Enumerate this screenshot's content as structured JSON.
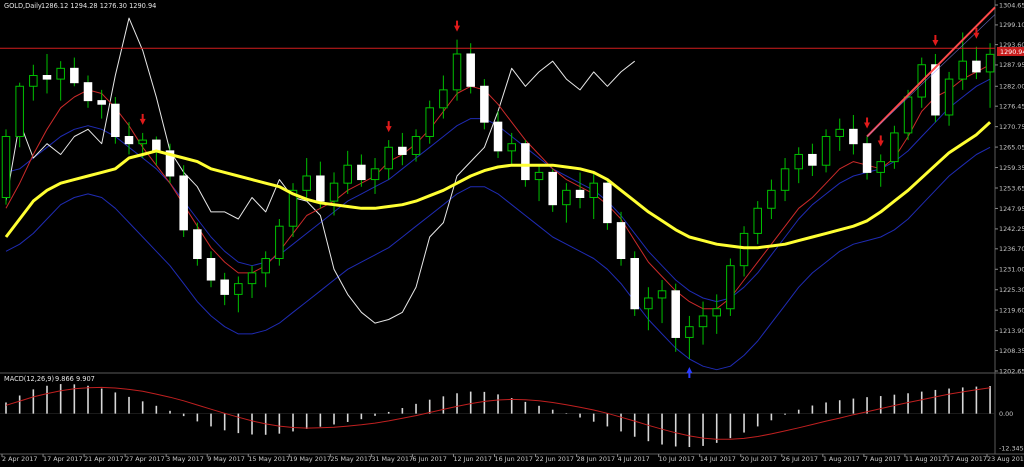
{
  "colors": {
    "background": "#000000",
    "grid": "#2a2a2a",
    "bull": "#ffffff",
    "bear": "#ffffff",
    "wick": "#00c000",
    "ma_slow": "#ffff33",
    "ma_red": "#cc2a2a",
    "ma_white": "#e8e8e8",
    "band_blue": "#1f2bb3",
    "level_line": "#d21e1e",
    "arrow_down": "#e01b1b",
    "arrow_up": "#2a3cff",
    "axis_text": "#c8c8c8",
    "price_tag": "#c81d1d",
    "macd_hist": "#d8d8d8",
    "macd_signal": "#c02020"
  },
  "chart_data": [
    {
      "type": "candlestick",
      "title": "GOLD,Daily",
      "ohlc_header": "1286.12 1294.28 1276.30 1290.94",
      "current_price": 1290.94,
      "resistance_level": 1292.6,
      "ylim": [
        1202.65,
        1304.65
      ],
      "y_ticks": [
        1304.65,
        1299.1,
        1293.6,
        1287.95,
        1282.0,
        1276.45,
        1270.75,
        1265.05,
        1259.35,
        1253.65,
        1247.95,
        1242.25,
        1236.7,
        1231.0,
        1225.3,
        1219.6,
        1213.9,
        1208.35,
        1202.65
      ],
      "x_labels": [
        "2 Apr 2017",
        "17 Apr 2017",
        "21 Apr 2017",
        "27 Apr 2017",
        "3 May 2017",
        "9 May 2017",
        "15 May 2017",
        "19 May 2017",
        "25 May 2017",
        "31 May 2017",
        "6 Jun 2017",
        "12 Jun 2017",
        "16 Jun 2017",
        "22 Jun 2017",
        "28 Jun 2017",
        "4 Jul 2017",
        "10 Jul 2017",
        "14 Jul 2017",
        "20 Jul 2017",
        "26 Jul 2017",
        "1 Aug 2017",
        "7 Aug 2017",
        "11 Aug 2017",
        "17 Aug 2017",
        "23 Aug 2017"
      ],
      "candles": [
        [
          1251.0,
          1270.0,
          1249.0,
          1268.0
        ],
        [
          1268.0,
          1283.0,
          1265.0,
          1282.0
        ],
        [
          1282.0,
          1288.0,
          1278.0,
          1285.0
        ],
        [
          1285.0,
          1291.0,
          1280.0,
          1284.0
        ],
        [
          1284.0,
          1289.0,
          1278.0,
          1287.0
        ],
        [
          1287.0,
          1290.0,
          1282.0,
          1283.0
        ],
        [
          1283.0,
          1285.0,
          1276.0,
          1278.0
        ],
        [
          1278.0,
          1281.0,
          1273.0,
          1277.0
        ],
        [
          1277.0,
          1279.0,
          1266.0,
          1268.0
        ],
        [
          1268.0,
          1272.0,
          1263.0,
          1266.0
        ],
        [
          1266.0,
          1269.0,
          1262.0,
          1267.0
        ],
        [
          1267.0,
          1268.0,
          1260.0,
          1264.0
        ],
        [
          1264.0,
          1266.0,
          1255.0,
          1257.0
        ],
        [
          1257.0,
          1260.0,
          1240.0,
          1242.0
        ],
        [
          1242.0,
          1244.0,
          1232.0,
          1234.0
        ],
        [
          1234.0,
          1236.0,
          1226.0,
          1228.0
        ],
        [
          1228.0,
          1230.0,
          1221.0,
          1224.0
        ],
        [
          1224.0,
          1229.0,
          1219.0,
          1227.0
        ],
        [
          1227.0,
          1232.0,
          1223.0,
          1230.0
        ],
        [
          1230.0,
          1236.0,
          1226.0,
          1234.0
        ],
        [
          1234.0,
          1245.0,
          1232.0,
          1243.0
        ],
        [
          1243.0,
          1255.0,
          1240.0,
          1253.0
        ],
        [
          1253.0,
          1262.0,
          1250.0,
          1257.0
        ],
        [
          1257.0,
          1261.0,
          1248.0,
          1250.0
        ],
        [
          1250.0,
          1258.0,
          1246.0,
          1255.0
        ],
        [
          1255.0,
          1264.0,
          1252.0,
          1260.0
        ],
        [
          1260.0,
          1263.0,
          1254.0,
          1256.0
        ],
        [
          1256.0,
          1262.0,
          1252.0,
          1259.0
        ],
        [
          1259.0,
          1267.0,
          1256.0,
          1265.0
        ],
        [
          1265.0,
          1269.0,
          1260.0,
          1263.0
        ],
        [
          1263.0,
          1270.0,
          1261.0,
          1268.0
        ],
        [
          1268.0,
          1278.0,
          1266.0,
          1276.0
        ],
        [
          1276.0,
          1285.0,
          1273.0,
          1281.0
        ],
        [
          1281.0,
          1295.0,
          1278.0,
          1291.0
        ],
        [
          1291.0,
          1294.0,
          1280.0,
          1282.0
        ],
        [
          1282.0,
          1284.0,
          1270.0,
          1272.0
        ],
        [
          1272.0,
          1275.0,
          1262.0,
          1264.0
        ],
        [
          1264.0,
          1269.0,
          1260.0,
          1266.0
        ],
        [
          1266.0,
          1267.0,
          1254.0,
          1256.0
        ],
        [
          1256.0,
          1260.0,
          1250.0,
          1258.0
        ],
        [
          1258.0,
          1259.0,
          1247.0,
          1249.0
        ],
        [
          1249.0,
          1255.0,
          1244.0,
          1253.0
        ],
        [
          1253.0,
          1258.0,
          1248.0,
          1251.0
        ],
        [
          1251.0,
          1258.0,
          1245.0,
          1255.0
        ],
        [
          1255.0,
          1256.0,
          1242.0,
          1244.0
        ],
        [
          1244.0,
          1247.0,
          1232.0,
          1234.0
        ],
        [
          1234.0,
          1236.0,
          1218.0,
          1220.0
        ],
        [
          1220.0,
          1226.0,
          1214.0,
          1223.0
        ],
        [
          1223.0,
          1228.0,
          1216.0,
          1225.0
        ],
        [
          1225.0,
          1227.0,
          1208.0,
          1212.0
        ],
        [
          1212.0,
          1218.0,
          1206.0,
          1215.0
        ],
        [
          1215.0,
          1222.0,
          1210.0,
          1218.0
        ],
        [
          1218.0,
          1224.0,
          1213.0,
          1220.0
        ],
        [
          1220.0,
          1234.0,
          1218.0,
          1232.0
        ],
        [
          1232.0,
          1243.0,
          1229.0,
          1241.0
        ],
        [
          1241.0,
          1250.0,
          1238.0,
          1248.0
        ],
        [
          1248.0,
          1256.0,
          1245.0,
          1253.0
        ],
        [
          1253.0,
          1262.0,
          1250.0,
          1259.0
        ],
        [
          1259.0,
          1265.0,
          1255.0,
          1263.0
        ],
        [
          1263.0,
          1266.0,
          1257.0,
          1260.0
        ],
        [
          1260.0,
          1270.0,
          1258.0,
          1268.0
        ],
        [
          1268.0,
          1273.0,
          1264.0,
          1270.0
        ],
        [
          1270.0,
          1274.0,
          1263.0,
          1266.0
        ],
        [
          1266.0,
          1268.0,
          1256.0,
          1258.0
        ],
        [
          1258.0,
          1263.0,
          1254.0,
          1261.0
        ],
        [
          1261.0,
          1271.0,
          1259.0,
          1269.0
        ],
        [
          1269.0,
          1281.0,
          1267.0,
          1279.0
        ],
        [
          1279.0,
          1290.0,
          1276.0,
          1288.0
        ],
        [
          1288.0,
          1291.0,
          1272.0,
          1274.0
        ],
        [
          1274.0,
          1286.0,
          1271.0,
          1284.0
        ],
        [
          1284.0,
          1297.0,
          1281.0,
          1289.0
        ],
        [
          1289.0,
          1293.0,
          1284.0,
          1286.0
        ],
        [
          1286.0,
          1294.0,
          1276.0,
          1290.9
        ]
      ],
      "series": [
        {
          "name": "",
          "values": [
            1240.0,
            1245.0,
            1250.0,
            1253.0,
            1255.0,
            1256.0,
            1257.0,
            1258.0,
            1259.0,
            1262.0,
            1263.0,
            1264.0,
            1263.0,
            1262.0,
            1261.0,
            1259.0,
            1258.0,
            1257.0,
            1256.0,
            1255.0,
            1254.0,
            1252.0,
            1250.5,
            1249.5,
            1249.0,
            1248.5,
            1248.0,
            1248.0,
            1248.5,
            1249.0,
            1250.0,
            1251.5,
            1253.0,
            1255.0,
            1257.0,
            1258.5,
            1259.5,
            1260.0,
            1260.0,
            1260.0,
            1260.0,
            1259.5,
            1259.0,
            1258.0,
            1256.0,
            1253.0,
            1250.0,
            1247.0,
            1244.5,
            1242.0,
            1240.0,
            1239.0,
            1238.0,
            1237.5,
            1237.0,
            1237.0,
            1237.5,
            1238.0,
            1239.0,
            1240.0,
            1241.0,
            1242.0,
            1243.0,
            1244.5,
            1247.0,
            1250.0,
            1253.0,
            1256.5,
            1260.0,
            1263.5,
            1266.0,
            1268.5,
            1272.0
          ]
        },
        {
          "name": "",
          "values": [
            1248.0,
            1255.0,
            1263.0,
            1270.0,
            1276.0,
            1279.0,
            1281.0,
            1280.0,
            1276.0,
            1271.0,
            1265.0,
            1260.0,
            1255.0,
            1249.0,
            1243.0,
            1237.0,
            1233.0,
            1230.0,
            1230.0,
            1232.0,
            1236.0,
            1241.0,
            1246.0,
            1248.0,
            1250.0,
            1253.0,
            1255.0,
            1257.0,
            1261.0,
            1263.0,
            1266.0,
            1270.0,
            1275.0,
            1280.0,
            1282.0,
            1281.0,
            1277.0,
            1272.0,
            1267.0,
            1263.0,
            1259.0,
            1256.0,
            1254.0,
            1252.0,
            1249.0,
            1245.0,
            1239.0,
            1233.0,
            1229.0,
            1225.0,
            1222.0,
            1220.0,
            1220.0,
            1223.0,
            1228.0,
            1233.0,
            1238.0,
            1243.0,
            1248.0,
            1251.0,
            1255.0,
            1259.0,
            1261.0,
            1260.0,
            1259.0,
            1262.0,
            1268.0,
            1275.0,
            1279.0,
            1281.0,
            1284.0,
            1286.0,
            1288.0
          ]
        },
        {
          "name": "",
          "values": [
            1250.0,
            1272.0,
            1262.0,
            1266.0,
            1263.0,
            1268.0,
            1270.0,
            1266.0,
            1285.0,
            1301.0,
            1292.0,
            1279.0,
            1264.0,
            1258.0,
            1254.0,
            1247.0,
            1247.0,
            1245.0,
            1251.0,
            1247.0,
            1256.0,
            1251.0,
            1250.0,
            1246.0,
            1231.0,
            1224.0,
            1219.0,
            1216.0,
            1217.0,
            1219.0,
            1226.0,
            1240.0,
            1244.0,
            1257.0,
            1261.0,
            1265.0,
            1275.0,
            1287.0,
            1282.0,
            1286.0,
            1289.0,
            1284.0,
            1281.0,
            1286.0,
            1282.0,
            1286.0,
            1289.0,
            null,
            null,
            null,
            null,
            null,
            null,
            null,
            null,
            null,
            null,
            null,
            null,
            null,
            null,
            null,
            null,
            null,
            null,
            null,
            null,
            null,
            null,
            null,
            null,
            null,
            null
          ]
        },
        {
          "name": "",
          "values": [
            1258.0,
            1259.0,
            1262.0,
            1265.0,
            1268.0,
            1270.0,
            1271.0,
            1270.0,
            1268.0,
            1265.0,
            1262.0,
            1259.0,
            1255.0,
            1250.0,
            1245.0,
            1240.0,
            1236.0,
            1233.0,
            1232.0,
            1233.0,
            1235.0,
            1238.0,
            1241.0,
            1244.0,
            1247.0,
            1250.0,
            1252.0,
            1254.0,
            1256.0,
            1259.0,
            1262.0,
            1265.0,
            1268.0,
            1271.0,
            1273.0,
            1273.0,
            1271.0,
            1268.0,
            1265.0,
            1262.0,
            1259.0,
            1257.0,
            1255.0,
            1253.0,
            1250.0,
            1246.0,
            1241.0,
            1236.0,
            1232.0,
            1228.0,
            1225.0,
            1223.0,
            1222.0,
            1223.0,
            1226.0,
            1230.0,
            1235.0,
            1240.0,
            1245.0,
            1249.0,
            1252.0,
            1255.0,
            1257.0,
            1258.0,
            1259.0,
            1261.0,
            1264.0,
            1268.0,
            1272.0,
            1276.0,
            1279.0,
            1282.0,
            1284.0
          ]
        },
        {
          "name": "",
          "values": [
            1236.0,
            1238.0,
            1241.0,
            1245.0,
            1249.0,
            1251.0,
            1252.0,
            1251.0,
            1248.0,
            1244.0,
            1240.0,
            1236.0,
            1232.0,
            1227.0,
            1222.0,
            1218.0,
            1215.0,
            1213.0,
            1213.0,
            1214.0,
            1216.0,
            1219.0,
            1222.0,
            1225.0,
            1228.0,
            1231.0,
            1233.0,
            1235.0,
            1237.0,
            1240.0,
            1243.0,
            1246.0,
            1249.0,
            1252.0,
            1254.0,
            1254.0,
            1252.0,
            1249.0,
            1246.0,
            1243.0,
            1240.0,
            1238.0,
            1236.0,
            1234.0,
            1231.0,
            1227.0,
            1222.0,
            1217.0,
            1213.0,
            1209.0,
            1206.0,
            1204.0,
            1203.0,
            1204.0,
            1207.0,
            1211.0,
            1216.0,
            1221.0,
            1226.0,
            1230.0,
            1233.0,
            1236.0,
            1238.0,
            1239.0,
            1240.0,
            1242.0,
            1245.0,
            1249.0,
            1253.0,
            1257.0,
            1260.0,
            1263.0,
            1265.0
          ]
        }
      ],
      "arrows_down_index": [
        10,
        28,
        33,
        63,
        64,
        68,
        71
      ],
      "arrows_up_index": [
        50
      ]
    },
    {
      "type": "bar",
      "title": "MACD(12,26,9)",
      "values_header": "9.866 9.907",
      "ylim": [
        -12.345,
        13.5
      ],
      "y_ticks": [
        0.0,
        -12.345
      ],
      "values": [
        4.0,
        6.5,
        8.7,
        10.0,
        10.6,
        10.5,
        10.0,
        9.0,
        7.6,
        6.0,
        4.4,
        2.8,
        1.0,
        -0.9,
        -2.8,
        -4.6,
        -6.0,
        -7.0,
        -7.5,
        -7.6,
        -7.2,
        -6.4,
        -5.5,
        -4.7,
        -3.9,
        -3.0,
        -2.0,
        -0.8,
        0.6,
        2.0,
        3.5,
        5.0,
        6.2,
        7.3,
        7.9,
        7.8,
        6.9,
        5.6,
        4.2,
        2.8,
        1.4,
        0.1,
        -1.4,
        -2.9,
        -4.6,
        -6.4,
        -8.3,
        -9.9,
        -11.1,
        -11.8,
        -12.0,
        -11.6,
        -10.5,
        -8.8,
        -6.8,
        -4.6,
        -2.4,
        -0.4,
        1.4,
        2.9,
        4.0,
        4.8,
        5.4,
        5.9,
        6.3,
        6.8,
        7.3,
        7.9,
        8.5,
        9.0,
        9.4,
        9.7,
        9.9
      ],
      "signal": [
        3.0,
        4.5,
        6.0,
        7.2,
        8.2,
        8.9,
        9.3,
        9.4,
        9.2,
        8.7,
        8.0,
        7.0,
        5.9,
        4.6,
        3.1,
        1.6,
        0.1,
        -1.3,
        -2.6,
        -3.7,
        -4.5,
        -5.0,
        -5.2,
        -5.1,
        -4.9,
        -4.5,
        -4.0,
        -3.4,
        -2.6,
        -1.7,
        -0.7,
        0.4,
        1.5,
        2.6,
        3.6,
        4.4,
        4.9,
        5.1,
        5.0,
        4.6,
        4.0,
        3.2,
        2.3,
        1.3,
        0.1,
        -1.3,
        -2.7,
        -4.2,
        -5.6,
        -6.9,
        -8.0,
        -8.8,
        -9.2,
        -9.2,
        -8.9,
        -8.2,
        -7.3,
        -6.2,
        -5.1,
        -3.9,
        -2.7,
        -1.6,
        -0.4,
        0.7,
        1.8,
        2.9,
        4.0,
        5.0,
        6.0,
        7.0,
        7.8,
        8.6,
        9.3
      ]
    }
  ]
}
